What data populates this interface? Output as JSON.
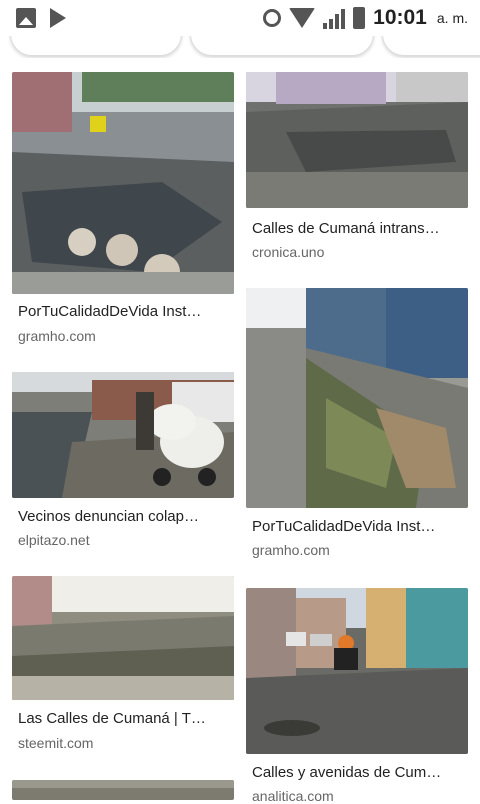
{
  "statusbar": {
    "time": "10:01",
    "ampm": "a. m.",
    "left_icons": [
      "gallery-icon",
      "play-store-icon"
    ],
    "right_icons": [
      "alarm-icon",
      "wifi-icon",
      "signal-icon",
      "battery-icon"
    ]
  },
  "results": [
    {
      "title": "PorTuCalidadDeVida Inst…",
      "source": "gramho.com"
    },
    {
      "title": "Calles de Cumaná intrans…",
      "source": "cronica.uno"
    },
    {
      "title": "Vecinos denuncian colap…",
      "source": "elpitazo.net"
    },
    {
      "title": "PorTuCalidadDeVida Inst…",
      "source": "gramho.com"
    },
    {
      "title": "Las Calles de Cumaná | T…",
      "source": "steemit.com"
    },
    {
      "title": "Calles y avenidas de Cum…",
      "source": "analitica.com"
    }
  ]
}
